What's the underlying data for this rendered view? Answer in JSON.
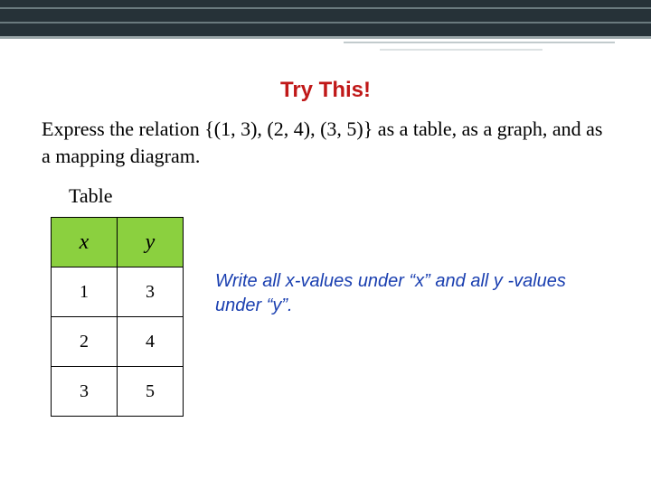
{
  "title": "Try This!",
  "prompt": "Express the relation {(1, 3), (2, 4), (3, 5)} as a table, as a graph, and as a mapping diagram.",
  "table_caption": "Table",
  "table": {
    "headers": {
      "x": "x",
      "y": "y"
    },
    "rows": [
      {
        "x": "1",
        "y": "3"
      },
      {
        "x": "2",
        "y": "4"
      },
      {
        "x": "3",
        "y": "5"
      }
    ]
  },
  "hint": "Write all x-values under “x” and all  y -values under “y”."
}
